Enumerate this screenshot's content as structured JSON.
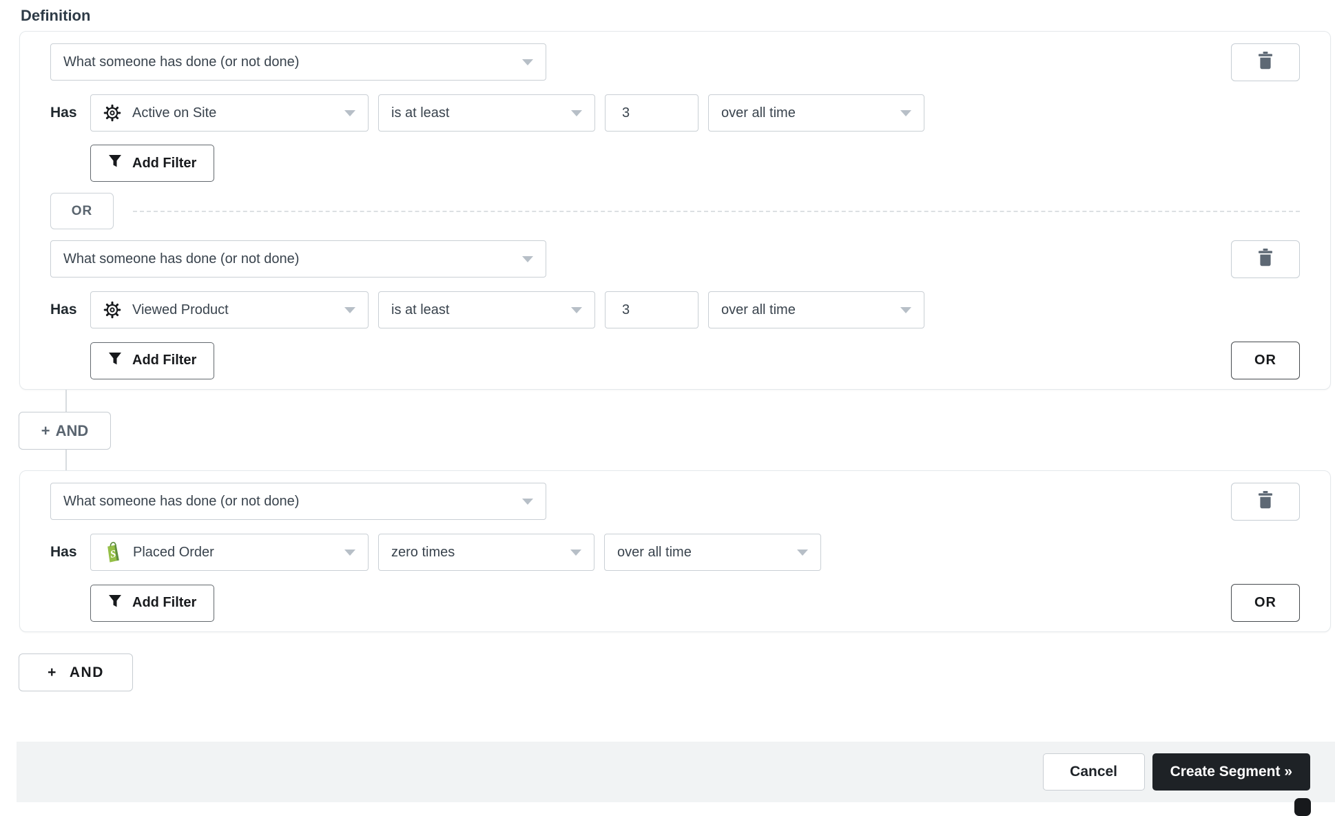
{
  "header": {
    "title": "Definition"
  },
  "segment": {
    "plus_sign": "+",
    "and_button_label": "AND",
    "groups": [
      {
        "or_connector_label": "OR",
        "conditions": [
          {
            "type": "What someone has done (or not done)",
            "prefix": "Has",
            "icon": "gear",
            "event": "Active on Site",
            "operator": "is at least",
            "quantity": "3",
            "timeframe": "over all time",
            "add_filter_label": "Add Filter"
          },
          {
            "type": "What someone has done (or not done)",
            "prefix": "Has",
            "icon": "gear",
            "event": "Viewed Product",
            "operator": "is at least",
            "quantity": "3",
            "timeframe": "over all time",
            "add_filter_label": "Add Filter",
            "or_button_label": "OR"
          }
        ]
      },
      {
        "conditions": [
          {
            "type": "What someone has done (or not done)",
            "prefix": "Has",
            "icon": "shopify-bag",
            "event": "Placed Order",
            "operator": "zero times",
            "timeframe": "over all time",
            "add_filter_label": "Add Filter",
            "or_button_label": "OR"
          }
        ]
      }
    ]
  },
  "footer": {
    "cancel_label": "Cancel",
    "create_label": "Create Segment »"
  },
  "colors": {
    "accent_dark": "#1e2226",
    "footer_bg": "#f1f3f4",
    "shopify_green": "#95BF47",
    "shopify_green_dark": "#5E8E3E",
    "connector_gray": "#d7dbdf"
  }
}
